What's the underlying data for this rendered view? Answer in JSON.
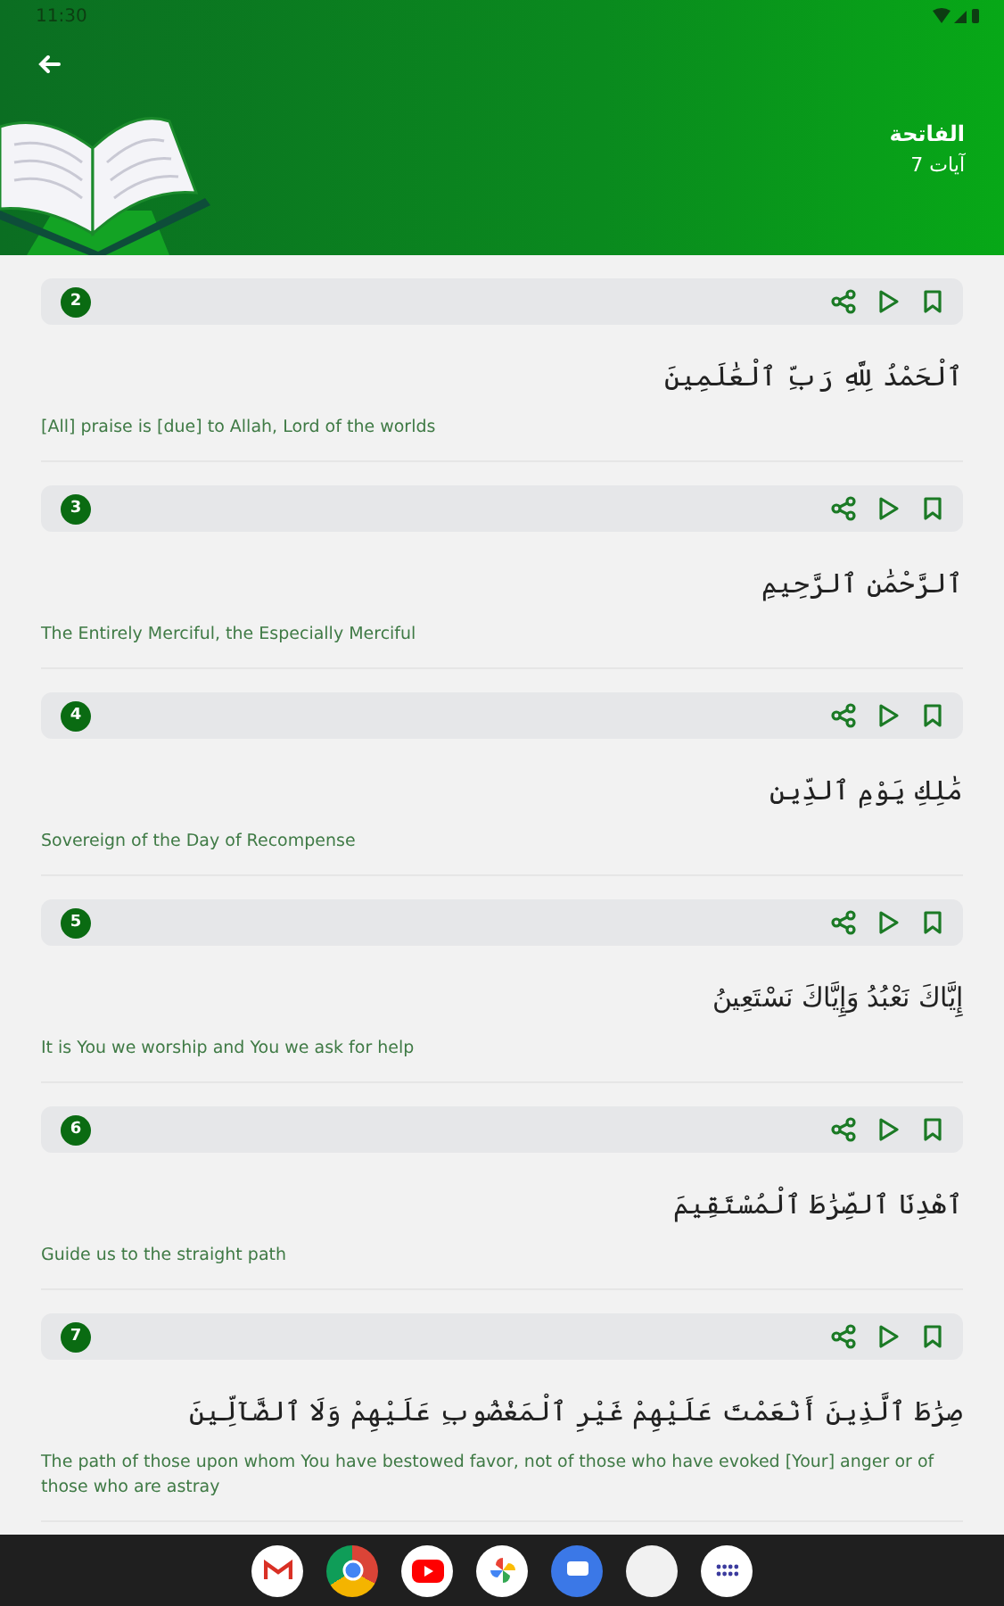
{
  "status_bar": {
    "time": "11:30"
  },
  "header": {
    "title": "الفاتحة",
    "subtitle": "7 آيات"
  },
  "verses": [
    {
      "number": "2",
      "arabic": "ٱلْحَمْدُ لِلَّهِ رَبِّ ٱلْعَٰلَمِينَ",
      "translation": "[All] praise is [due] to Allah, Lord of the worlds"
    },
    {
      "number": "3",
      "arabic": "ٱلرَّحْمَٰنِ ٱلرَّحِيمِ",
      "translation": "The Entirely Merciful, the Especially Merciful"
    },
    {
      "number": "4",
      "arabic": "مَٰلِكِ يَوْمِ ٱلدِّينِ",
      "translation": "Sovereign of the Day of Recompense"
    },
    {
      "number": "5",
      "arabic": "إِيَّاكَ نَعْبُدُ وَإِيَّاكَ نَسْتَعِينُ",
      "translation": "It is You we worship and You we ask for help"
    },
    {
      "number": "6",
      "arabic": "ٱهْدِنَا ٱلصِّرَٰطَ ٱلْمُسْتَقِيمَ",
      "translation": "Guide us to the straight path"
    },
    {
      "number": "7",
      "arabic": "صِرَٰطَ ٱلَّذِينَ أَنْعَمْتَ عَلَيْهِمْ غَيْرِ ٱلْمَغْضُوبِ عَلَيْهِمْ وَلَا ٱلضَّآلِّينَ",
      "translation": "The path of those upon whom You have bestowed favor, not of those who have evoked [Your] anger or of those who are astray"
    }
  ]
}
